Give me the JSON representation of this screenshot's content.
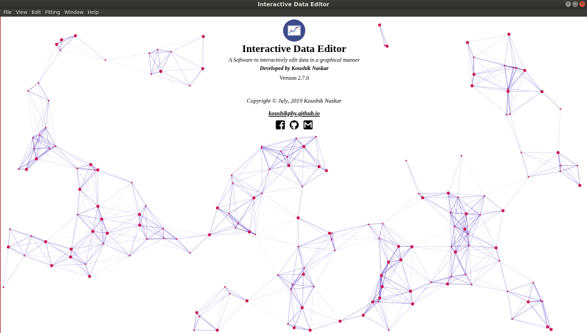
{
  "window": {
    "title": "Interactive Data Editor"
  },
  "menubar": {
    "items": [
      "File",
      "View",
      "Edit",
      "Fitting",
      "Window",
      "Help"
    ]
  },
  "about": {
    "app_title": "Interactive Data Editor",
    "subtitle": "A Software to interactively edit data in a graphical manner",
    "developer": "Developed by Koushik Naskar",
    "version": "Version 2.7.0",
    "copyright": "Copyright © July, 2019 Koushik Naskar",
    "website": "koushikphy.github.io",
    "icons": [
      "facebook-icon",
      "github-icon",
      "gmail-icon"
    ]
  },
  "colors": {
    "node": "#d0104a",
    "edge": "#5b3fc4",
    "logo_bg": "#3e4a8a"
  }
}
